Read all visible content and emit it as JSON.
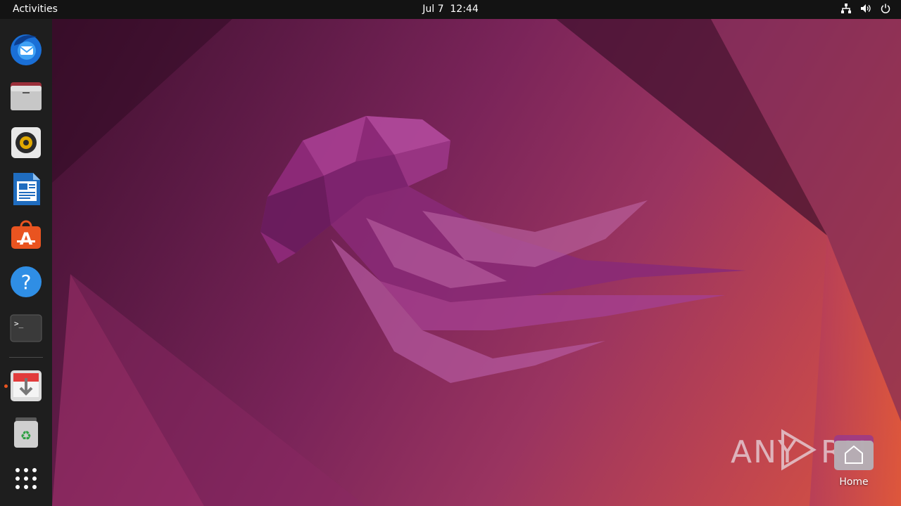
{
  "topbar": {
    "activities_label": "Activities",
    "date": "Jul 7",
    "time": "12:44",
    "tray_icons": [
      "network-icon",
      "volume-icon",
      "power-icon"
    ]
  },
  "dock": {
    "items": [
      {
        "name": "thunderbird-mail",
        "icon": "thunderbird-icon"
      },
      {
        "name": "files",
        "icon": "folder-icon"
      },
      {
        "name": "rhythmbox",
        "icon": "speaker-icon"
      },
      {
        "name": "libreoffice-writer",
        "icon": "document-icon"
      },
      {
        "name": "ubuntu-software",
        "icon": "software-store-icon"
      },
      {
        "name": "help",
        "icon": "question-icon"
      },
      {
        "name": "terminal",
        "icon": "terminal-icon"
      },
      {
        "name": "software-updater",
        "icon": "updater-icon",
        "running": true
      },
      {
        "name": "trash",
        "icon": "trash-icon"
      },
      {
        "name": "show-applications",
        "icon": "app-grid-icon"
      }
    ]
  },
  "desktop": {
    "home_label": "Home"
  },
  "watermark": {
    "text": "ANY RUN"
  },
  "colors": {
    "topbar": "#131313",
    "dock": "#1e1e1e",
    "accent": "#e95420"
  }
}
